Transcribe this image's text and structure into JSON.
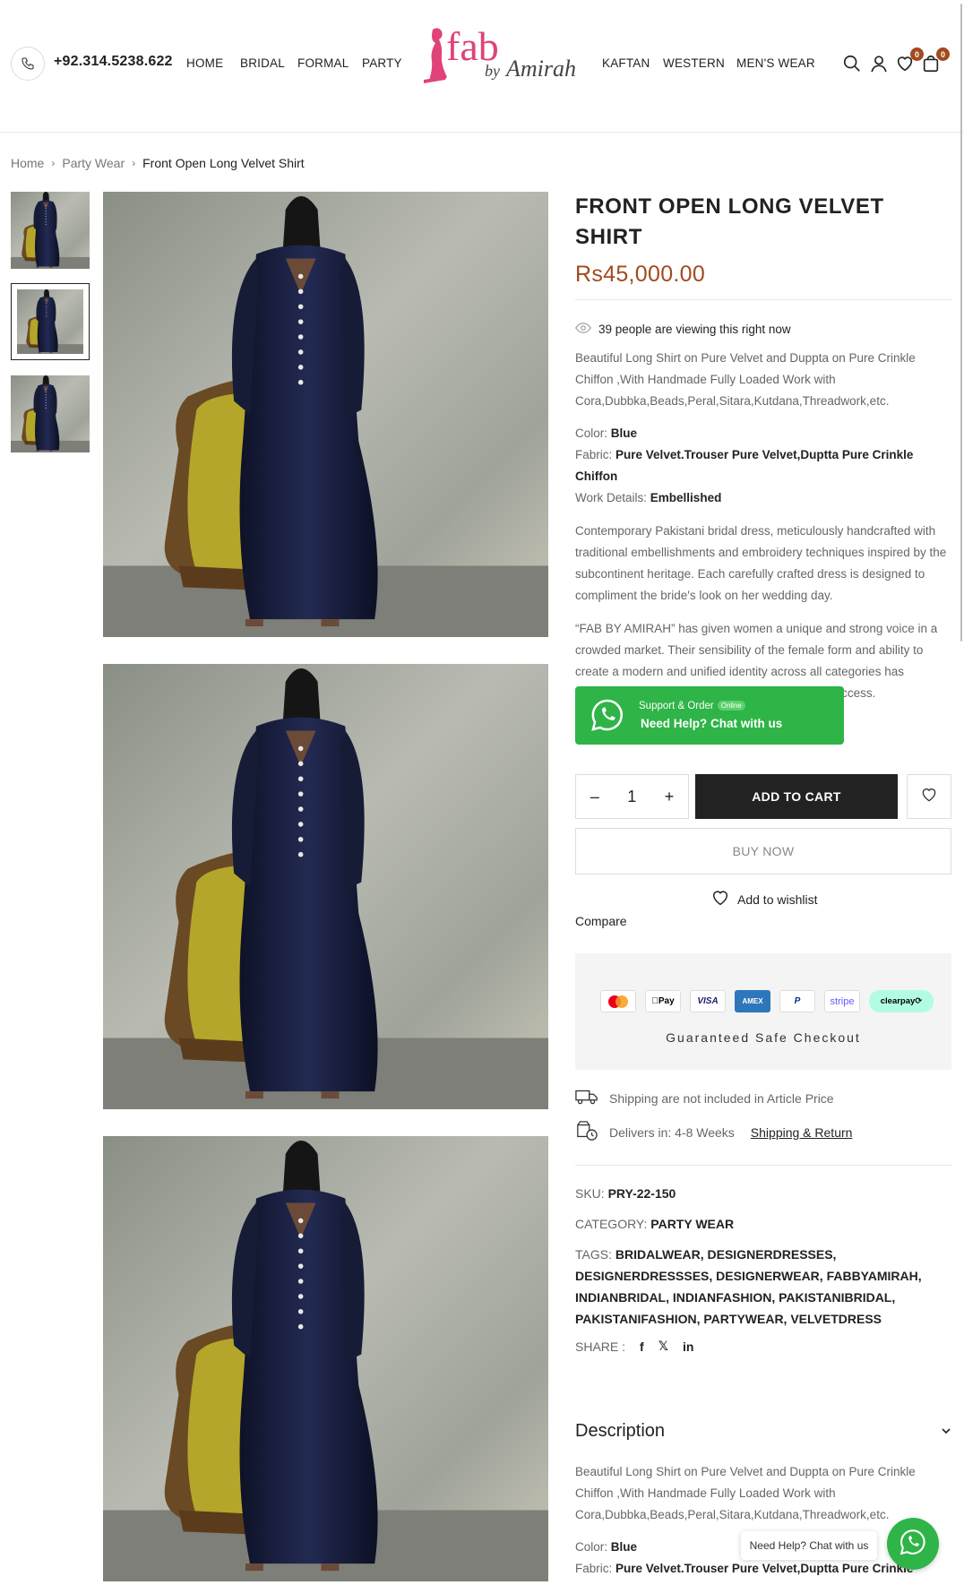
{
  "header": {
    "phone": "+92.314.5238.622",
    "nav_left": [
      "HOME",
      "BRIDAL",
      "FORMAL",
      "PARTY"
    ],
    "nav_right": [
      "KAFTAN",
      "WESTERN",
      "MEN'S WEAR"
    ],
    "logo_fab": "fab",
    "logo_by": "by",
    "logo_amirah": "Amirah",
    "wishlist_count": "0",
    "cart_count": "0"
  },
  "breadcrumb": [
    "Home",
    "Party Wear",
    "Front Open Long Velvet Shirt"
  ],
  "product": {
    "title": "FRONT OPEN LONG VELVET SHIRT",
    "price": "Rs45,000.00",
    "viewing": "39 people are viewing this right now",
    "short_desc": "Beautiful Long Shirt on Pure Velvet and Duppta on Pure Crinkle Chiffon ,With Handmade Fully Loaded Work with Cora,Dubbka,Beads,Peral,Sitara,Kutdana,Threadwork,etc.",
    "color_label": "Color:",
    "color_value": "Blue",
    "fabric_label": "Fabric:",
    "fabric_value": "Pure Velvet.Trouser Pure Velvet,Duptta Pure Crinkle Chiffon",
    "work_label": "Work Details:",
    "work_value": "Embellished",
    "para1": "Contemporary Pakistani bridal dress, meticulously handcrafted with traditional embellishments and embroidery techniques inspired by the subcontinent heritage. Each carefully crafted dress is designed to compliment the bride's look on her wedding day.",
    "para2": "“FAB BY AMIRAH” has given women a unique and strong voice in a crowded market. Their sensibility of the female form and ability to create a modern and unified identity across all categories has propelled the Zuria Dor brand into international success."
  },
  "whatsapp": {
    "small": "Support & Order",
    "online": "Online",
    "big": "Need Help? Chat with us"
  },
  "cart": {
    "minus": "–",
    "quantity": "1",
    "plus": "+",
    "add_to_cart": "ADD TO CART",
    "buy_now": "BUY NOW",
    "add_to_wishlist": "Add to wishlist",
    "compare": "Compare"
  },
  "payments": {
    "methods": [
      "",
      "Pay",
      "VISA",
      "AMEX",
      "P",
      "stripe",
      "clearpay⟳"
    ],
    "guaranteed": "Guaranteed Safe Checkout"
  },
  "shipping": {
    "note": "Shipping are not included in Article Price",
    "delivers": "Delivers in: 4-8 Weeks",
    "link": "Shipping & Return"
  },
  "meta": {
    "sku_label": "SKU:",
    "sku": "PRY-22-150",
    "category_label": "CATEGORY:",
    "category": "PARTY WEAR",
    "tags_label": "TAGS:",
    "tags": "BRIDALWEAR, DESIGNERDRESSES, DESIGNERDRESSSES, DESIGNERWEAR, FABBYAMIRAH, INDIANBRIDAL, INDIANFASHION, PAKISTANIBRIDAL, PAKISTANIFASHION, PARTYWEAR, VELVETDRESS",
    "share_label": "SHARE :",
    "share_icons": [
      "f",
      "𝕏",
      "in"
    ]
  },
  "description": {
    "heading": "Description",
    "text": "Beautiful Long Shirt on Pure Velvet and Duppta on Pure Crinkle Chiffon ,With Handmade Fully Loaded Work with Cora,Dubbka,Beads,Peral,Sitara,Kutdana,Threadwork,etc.",
    "color_label": "Color:",
    "color_value": "Blue",
    "fabric_label": "Fabric:",
    "fabric_value": "Pure Velvet.Trouser Pure Velvet,Duptta Pure Crinkle"
  },
  "float": {
    "label": "Need Help? Chat with us"
  },
  "colors": {
    "accent": "#a24a1e",
    "whatsapp": "#2fb447",
    "dress": "#141a33",
    "chair": "#b3a62a"
  }
}
